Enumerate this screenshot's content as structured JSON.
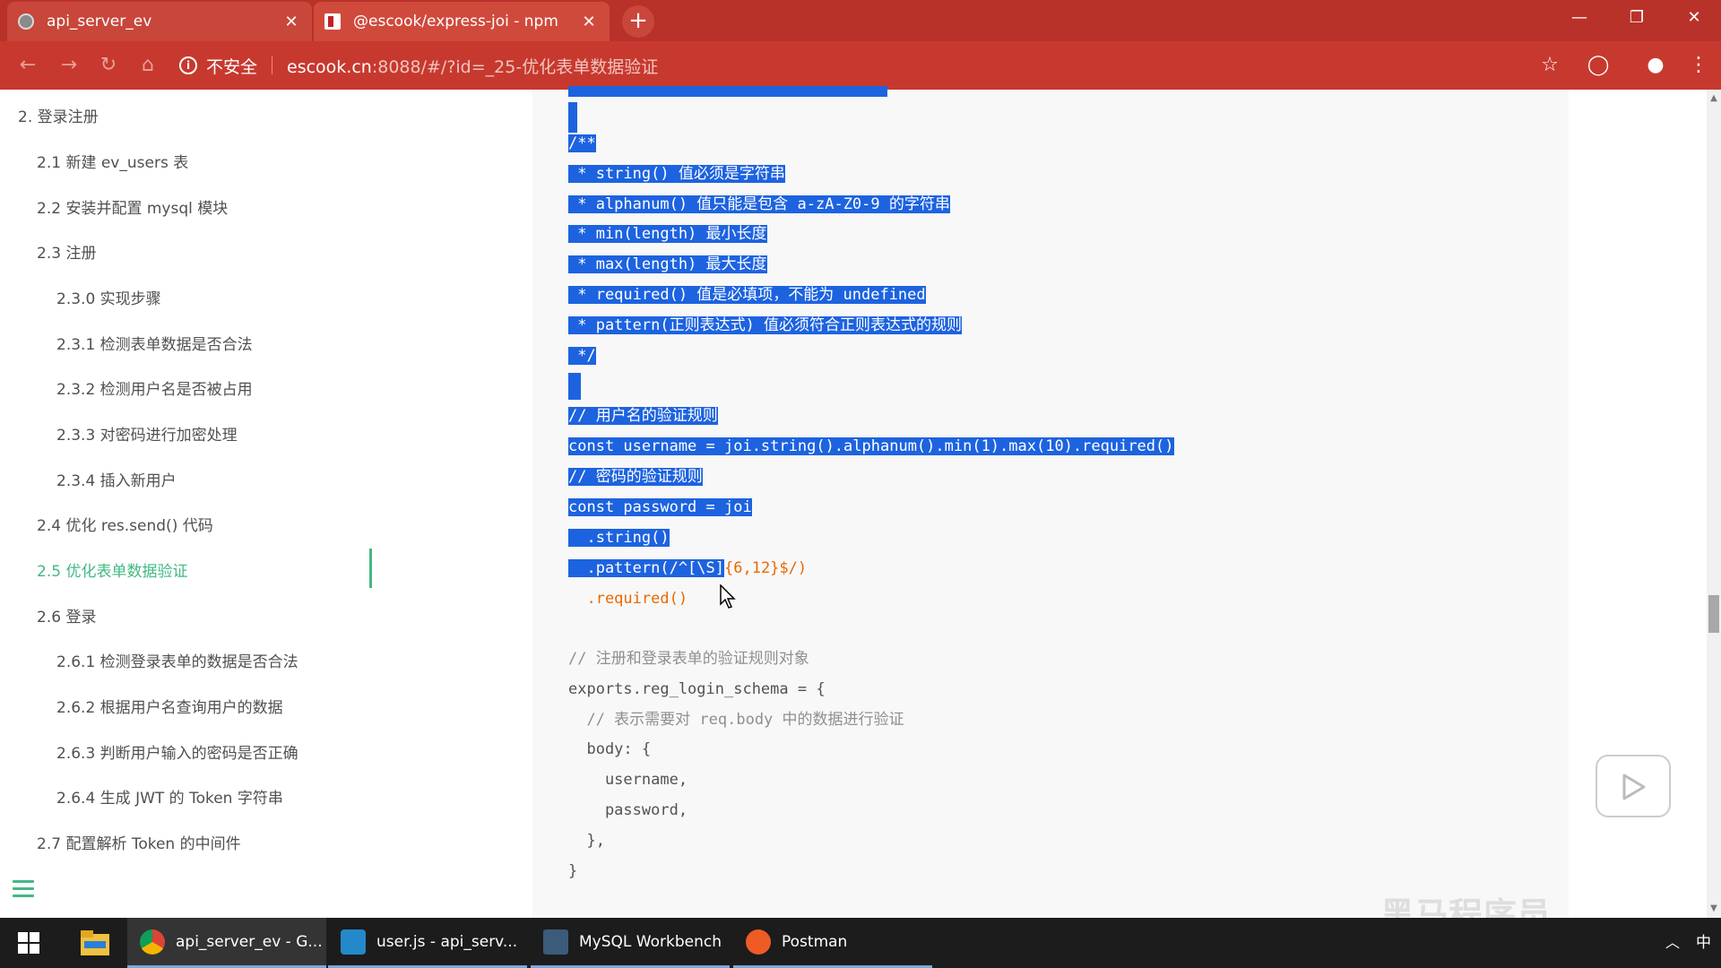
{
  "browser": {
    "tabs": [
      {
        "title": "api_server_ev",
        "active": true
      },
      {
        "title": "@escook/express-joi - npm",
        "active": false
      }
    ],
    "new_tab": "+",
    "close_glyph": "✕",
    "address": {
      "security_label": "不安全",
      "url_host": "escook.cn",
      "url_rest": ":8088/#/?id=_25-优化表单数据验证"
    }
  },
  "sidebar": {
    "items": [
      {
        "label": "2. 登录注册"
      },
      {
        "label": "2.1 新建 ev_users 表"
      },
      {
        "label": "2.2 安装并配置 mysql 模块"
      },
      {
        "label": "2.3 注册"
      },
      {
        "label": "2.3.0 实现步骤"
      },
      {
        "label": "2.3.1 检测表单数据是否合法"
      },
      {
        "label": "2.3.2 检测用户名是否被占用"
      },
      {
        "label": "2.3.3 对密码进行加密处理"
      },
      {
        "label": "2.3.4 插入新用户"
      },
      {
        "label": "2.4 优化 res.send() 代码"
      },
      {
        "label": "2.5 优化表单数据验证",
        "active": true
      },
      {
        "label": "2.6 登录"
      },
      {
        "label": "2.6.1 检测登录表单的数据是否合法"
      },
      {
        "label": "2.6.2 根据用户名查询用户的数据"
      },
      {
        "label": "2.6.3 判断用户输入的密码是否正确"
      },
      {
        "label": "2.6.4 生成 JWT 的 Token 字符串"
      },
      {
        "label": "2.7 配置解析 Token 的中间件"
      }
    ]
  },
  "code": {
    "lines": [
      "/**",
      " * string() 值必须是字符串",
      " * alphanum() 值只能是包含 a-zA-Z0-9 的字符串",
      " * min(length) 最小长度",
      " * max(length) 最大长度",
      " * required() 值是必填项，不能为 undefined",
      " * pattern(正则表达式) 值必须符合正则表达式的规则",
      " */",
      "// 用户名的验证规则",
      "const username = joi.string().alphanum().min(1).max(10).required()",
      "// 密码的验证规则",
      "const password = joi",
      "  .string()",
      "  .pattern(/^[\\S]",
      "{6,12}$/)",
      "  .required()",
      "// 注册和登录表单的验证规则对象",
      "exports.reg_login_schema = {",
      "  // 表示需要对 req.body 中的数据进行验证",
      "  body: {",
      "    username,",
      "    password,",
      "  },",
      "}"
    ]
  },
  "watermark": "黑马程序员",
  "taskbar": {
    "apps": [
      {
        "label": "api_server_ev - G...",
        "icon": "chrome-icon"
      },
      {
        "label": "user.js - api_serv...",
        "icon": "vscode-icon"
      },
      {
        "label": "MySQL Workbench",
        "icon": "mysql-workbench-icon"
      },
      {
        "label": "Postman",
        "icon": "postman-icon"
      }
    ],
    "ime": "中"
  },
  "colors": {
    "accent": "#42b983",
    "selection": "#1d63e0",
    "chrome_red": "#c7392e"
  }
}
